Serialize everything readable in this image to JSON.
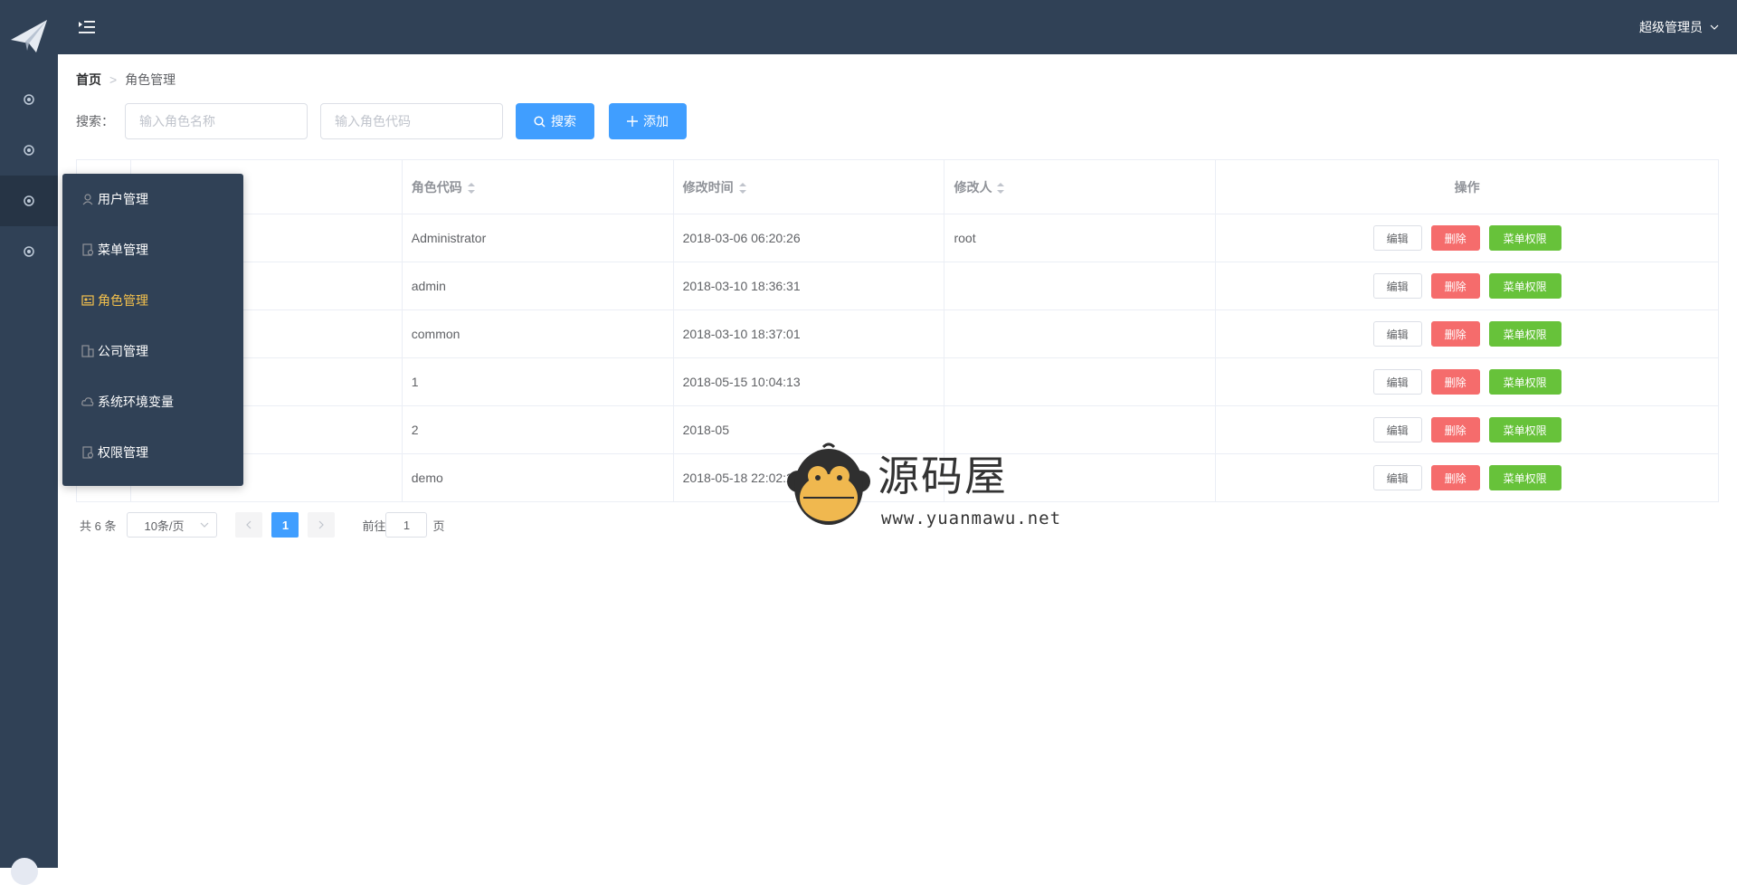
{
  "header": {
    "user_name": "超级管理员"
  },
  "flyout": {
    "items": [
      {
        "label": "用户管理",
        "icon": "user-icon"
      },
      {
        "label": "菜单管理",
        "icon": "menu-doc-icon"
      },
      {
        "label": "角色管理",
        "icon": "role-icon"
      },
      {
        "label": "公司管理",
        "icon": "company-icon"
      },
      {
        "label": "系统环境变量",
        "icon": "cloud-icon"
      },
      {
        "label": "权限管理",
        "icon": "permission-icon"
      }
    ]
  },
  "breadcrumb": {
    "home": "首页",
    "current": "角色管理"
  },
  "search": {
    "label": "搜索：",
    "name_placeholder": "输入角色名称",
    "code_placeholder": "输入角色代码",
    "search_button": "搜索",
    "add_button": "添加"
  },
  "table": {
    "headers": {
      "code": "角色代码",
      "time": "修改时间",
      "modifier": "修改人",
      "actions": "操作"
    },
    "rows": [
      {
        "code": "Administrator",
        "time": "2018-03-06 06:20:26",
        "modifier": "root"
      },
      {
        "code": "admin",
        "time": "2018-03-10 18:36:31",
        "modifier": ""
      },
      {
        "code": "common",
        "time": "2018-03-10 18:37:01",
        "modifier": ""
      },
      {
        "code": "1",
        "time": "2018-05-15 10:04:13",
        "modifier": ""
      },
      {
        "code": "2",
        "time": "2018-05",
        "modifier": ""
      },
      {
        "code": "demo",
        "time": "2018-05-18 22:02:28",
        "modifier": ""
      }
    ],
    "edit_label": "编辑",
    "delete_label": "删除",
    "perm_label": "菜单权限"
  },
  "pagination": {
    "total": "共 6 条",
    "page_size": "10条/页",
    "current_page": "1",
    "goto_prefix": "前往",
    "goto_value": "1",
    "goto_suffix": "页"
  },
  "watermark": {
    "title": "源码屋",
    "url": "www.yuanmawu.net"
  },
  "colors": {
    "sidebar": "#304156",
    "primary": "#409eff",
    "danger": "#f56c6c",
    "success": "#67c23a",
    "active": "#f4c14c"
  }
}
